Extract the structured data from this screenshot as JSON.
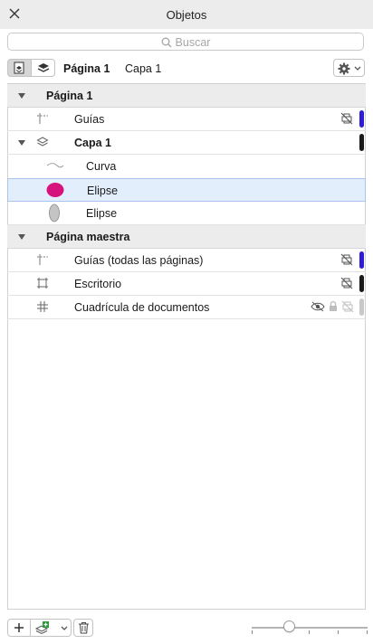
{
  "window": {
    "title": "Objetos"
  },
  "search": {
    "placeholder": "Buscar"
  },
  "toolbar": {
    "page_label": "Página 1",
    "layer_label": "Capa 1"
  },
  "colors": {
    "guides_bar": "#2e1cd6",
    "layer_bar": "#1a1a1a",
    "ellipse_fill": "#d6127c",
    "selected_bg": "#e3eefc",
    "grid_bar": "#c8c8c8"
  },
  "tree": {
    "page1": {
      "label": "Página 1"
    },
    "guides": {
      "label": "Guías"
    },
    "layer1": {
      "label": "Capa 1"
    },
    "curve": {
      "label": "Curva"
    },
    "ellipse_selected": {
      "label": "Elipse"
    },
    "ellipse2": {
      "label": "Elipse"
    },
    "master": {
      "label": "Página maestra"
    },
    "master_guides": {
      "label": "Guías (todas las páginas)"
    },
    "desktop": {
      "label": "Escritorio"
    },
    "grid": {
      "label": "Cuadrícula de documentos"
    }
  }
}
